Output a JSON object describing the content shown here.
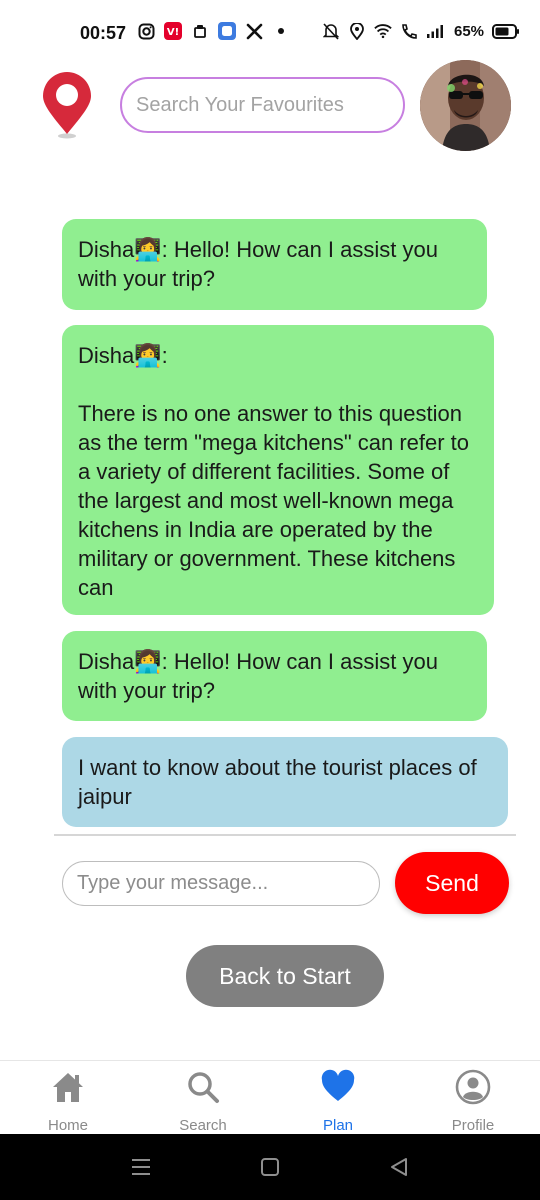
{
  "status_bar": {
    "time": "00:57",
    "battery": "65%"
  },
  "header": {
    "search_placeholder": "Search Your Favourites"
  },
  "chat": {
    "messages": [
      {
        "role": "bot",
        "text": "Disha👩‍💻: Hello! How can I assist you with your trip?"
      },
      {
        "role": "bot",
        "text": "Disha👩‍💻:\n\nThere is no one answer to this question as the term \"mega kitchens\" can refer to a variety of different facilities. Some of the largest and most well-known mega kitchens in India are operated by the military or government. These kitchens can"
      },
      {
        "role": "bot",
        "text": "Disha👩‍💻: Hello! How can I assist you with your trip?"
      },
      {
        "role": "user",
        "text": "I want to know about the tourist places of jaipur"
      }
    ]
  },
  "composer": {
    "placeholder": "Type your message...",
    "send_label": "Send"
  },
  "back_label": "Back to Start",
  "bottom_nav": {
    "items": [
      {
        "label": "Home",
        "icon": "home-icon"
      },
      {
        "label": "Search",
        "icon": "search-icon"
      },
      {
        "label": "Plan",
        "icon": "heart-icon",
        "active": true
      },
      {
        "label": "Profile",
        "icon": "profile-icon"
      }
    ]
  },
  "colors": {
    "bot_bubble": "#90ee90",
    "user_bubble": "#add8e6",
    "send": "#ff0000",
    "active_nav": "#1e73e8",
    "logo": "#d6293b"
  }
}
